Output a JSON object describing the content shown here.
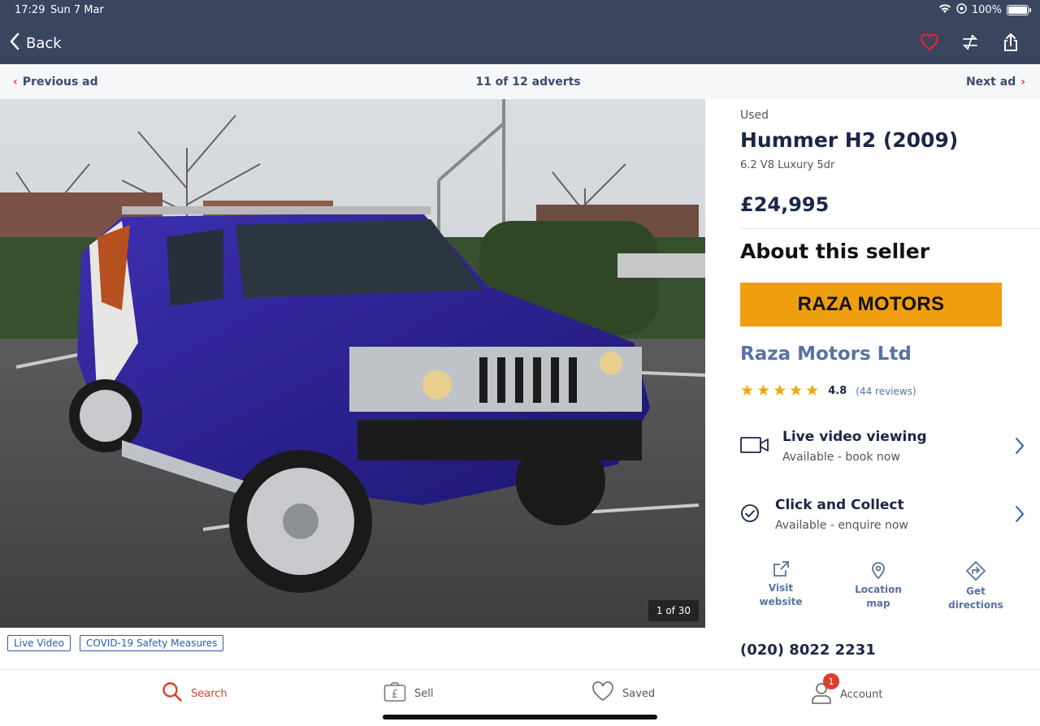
{
  "status": {
    "time": "17:29",
    "date": "Sun 7 Mar",
    "battery": "100%"
  },
  "header": {
    "back_label": "Back",
    "icons": [
      "heart-icon",
      "compare-icon",
      "share-icon"
    ]
  },
  "ad_nav": {
    "previous": "Previous ad",
    "counter": "11 of 12 adverts",
    "next": "Next ad"
  },
  "gallery": {
    "counter": "1 of 30"
  },
  "tags": [
    "Live Video",
    "COVID-19 Safety Measures"
  ],
  "listing": {
    "condition": "Used",
    "title": "Hummer H2 (2009)",
    "subtitle": "6.2 V8 Luxury 5dr",
    "price": "£24,995"
  },
  "seller": {
    "section_title": "About this seller",
    "logo_text": "RAZA MOTORS",
    "name": "Raza Motors Ltd",
    "rating": "4.8",
    "stars": 5,
    "reviews": "(44 reviews)",
    "phone": "(020) 8022 2231"
  },
  "features": [
    {
      "title": "Live video viewing",
      "subtitle": "Available - book now"
    },
    {
      "title": "Click and Collect",
      "subtitle": "Available - enquire now"
    }
  ],
  "links": [
    {
      "line1": "Visit",
      "line2": "website"
    },
    {
      "line1": "Location",
      "line2": "map"
    },
    {
      "line1": "Get",
      "line2": "directions"
    }
  ],
  "tabbar": {
    "search": "Search",
    "sell": "Sell",
    "saved": "Saved",
    "account": "Account",
    "account_badge": "1"
  },
  "colors": {
    "header_bg": "#3a4560",
    "accent_red": "#e03e2d",
    "logo_bg": "#ef9e0f",
    "seller_blue": "#5872a3",
    "star": "#f2a50d"
  }
}
